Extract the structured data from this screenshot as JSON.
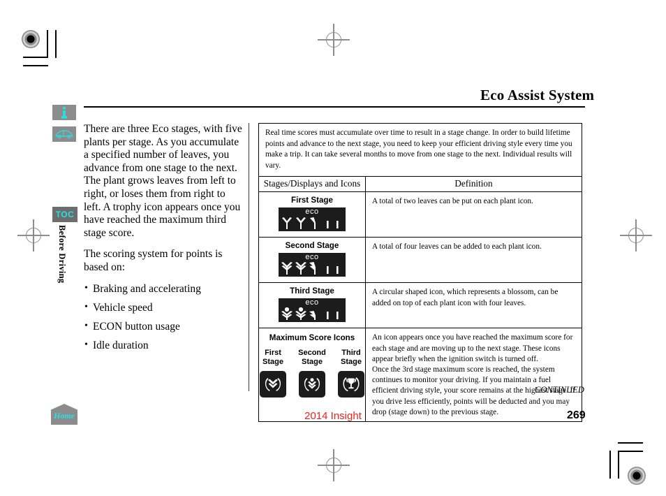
{
  "page": {
    "title": "Eco Assist System",
    "section_tab": "Before Driving",
    "toc_label": "TOC",
    "home_label": "Home",
    "continued_label": "CONTINUED",
    "model_year": "2014 Insight",
    "page_number": "269"
  },
  "icons": {
    "info": "info-icon",
    "vehicle": "car-icon",
    "home": "home-icon"
  },
  "body": {
    "paragraphs": [
      "There are three Eco stages, with five plants per stage. As you accumulate a specified number of leaves, you advance from one stage to the next. The plant grows leaves from left to right, or loses them from right to left. A trophy icon appears once you have reached the maximum third stage score.",
      "The scoring system for points is based on:"
    ],
    "bullets": [
      "Braking and accelerating",
      "Vehicle speed",
      "ECON button usage",
      "Idle duration"
    ]
  },
  "table": {
    "intro": "Real time scores must accumulate over time to result in a stage change. In order to build lifetime points and advance to the next stage, you need to keep your efficient driving style every time you make a trip. It can take several months to move from one stage to the next. Individual results will vary.",
    "headers": {
      "left": "Stages/Displays and Icons",
      "right": "Definition"
    },
    "rows": [
      {
        "stage_name": "First Stage",
        "display_text": "eco",
        "definition": "A total of two leaves can be put on each plant icon."
      },
      {
        "stage_name": "Second Stage",
        "display_text": "eco",
        "definition": "A total of four leaves can be added to each plant icon."
      },
      {
        "stage_name": "Third Stage",
        "display_text": "eco",
        "definition": "A circular shaped icon, which represents a blossom, can be added on top of each plant icon with four leaves."
      }
    ],
    "max_score": {
      "title": "Maximum Score Icons",
      "columns": [
        {
          "label_line1": "First",
          "label_line2": "Stage"
        },
        {
          "label_line1": "Second",
          "label_line2": "Stage"
        },
        {
          "label_line1": "Third",
          "label_line2": "Stage"
        }
      ],
      "definition_paragraphs": [
        "An icon appears once you have reached the maximum score for each stage and are moving up to the next stage. These icons appear briefly when the ignition switch is turned off.",
        "Once the 3rd stage maximum score is reached, the system continues to monitor your driving. If you maintain a fuel efficient driving style, your score remains at the highest stage. If you drive less efficiently, points will be deducted and you may drop (stage down) to the previous stage."
      ]
    }
  },
  "colors": {
    "accent_cyan": "#23e3e8",
    "tab_gray": "#8c8c8c",
    "model_red": "#e8241e",
    "display_black": "#1c1c1c"
  }
}
